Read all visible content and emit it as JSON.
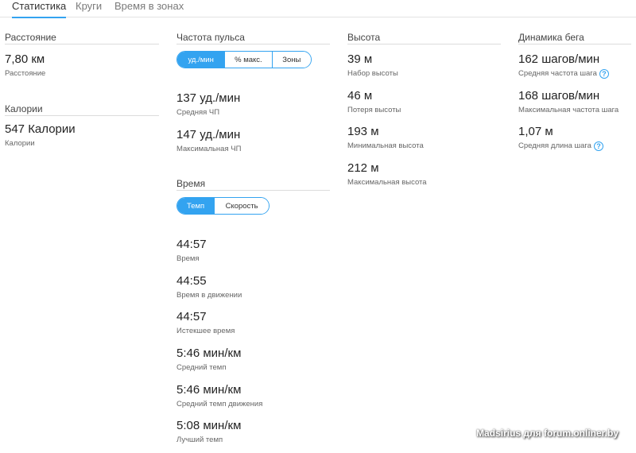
{
  "tabs": [
    {
      "label": "Статистика",
      "active": true
    },
    {
      "label": "Круги",
      "active": false
    },
    {
      "label": "Время в зонах",
      "active": false
    }
  ],
  "distance": {
    "title": "Расстояние",
    "value": "7,80 км",
    "label": "Расстояние"
  },
  "calories": {
    "title": "Калории",
    "value": "547 Калории",
    "label": "Калории"
  },
  "heart_rate": {
    "title": "Частота пульса",
    "toggle": [
      "уд./мин",
      "% макс.",
      "Зоны"
    ],
    "stats": [
      {
        "value": "137 уд./мин",
        "label": "Средняя ЧП"
      },
      {
        "value": "147 уд./мин",
        "label": "Максимальная ЧП"
      }
    ]
  },
  "time": {
    "title": "Время",
    "toggle": [
      "Темп",
      "Скорость"
    ],
    "stats": [
      {
        "value": "44:57",
        "label": "Время"
      },
      {
        "value": "44:55",
        "label": "Время в движении"
      },
      {
        "value": "44:57",
        "label": "Истекшее время"
      },
      {
        "value": "5:46 мин/км",
        "label": "Средний темп"
      },
      {
        "value": "5:46 мин/км",
        "label": "Средний темп движения"
      },
      {
        "value": "5:08 мин/км",
        "label": "Лучший темп"
      }
    ]
  },
  "elevation": {
    "title": "Высота",
    "stats": [
      {
        "value": "39 м",
        "label": "Набор высоты"
      },
      {
        "value": "46 м",
        "label": "Потеря высоты"
      },
      {
        "value": "193 м",
        "label": "Минимальная высота"
      },
      {
        "value": "212 м",
        "label": "Максимальная высота"
      }
    ]
  },
  "running_dynamics": {
    "title": "Динамика бега",
    "help_glyph": "?",
    "stats": [
      {
        "value": "162 шагов/мин",
        "label": "Средняя частота шага"
      },
      {
        "value": "168 шагов/мин",
        "label": "Максимальная частота шага"
      },
      {
        "value": "1,07 м",
        "label": "Средняя длина шага"
      }
    ]
  },
  "watermark": "Madsirius для forum.onliner.by",
  "colors": {
    "accent": "#33a3f0",
    "text": "#333333",
    "muted": "#666666",
    "divider": "#dcdcdc"
  }
}
